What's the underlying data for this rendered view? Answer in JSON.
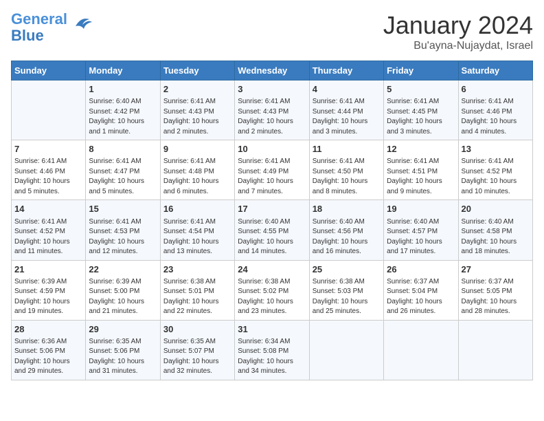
{
  "header": {
    "logo_general": "General",
    "logo_blue": "Blue",
    "month": "January 2024",
    "location": "Bu'ayna-Nujaydat, Israel"
  },
  "days_of_week": [
    "Sunday",
    "Monday",
    "Tuesday",
    "Wednesday",
    "Thursday",
    "Friday",
    "Saturday"
  ],
  "weeks": [
    [
      {
        "day": "",
        "content": ""
      },
      {
        "day": "1",
        "content": "Sunrise: 6:40 AM\nSunset: 4:42 PM\nDaylight: 10 hours\nand 1 minute."
      },
      {
        "day": "2",
        "content": "Sunrise: 6:41 AM\nSunset: 4:43 PM\nDaylight: 10 hours\nand 2 minutes."
      },
      {
        "day": "3",
        "content": "Sunrise: 6:41 AM\nSunset: 4:43 PM\nDaylight: 10 hours\nand 2 minutes."
      },
      {
        "day": "4",
        "content": "Sunrise: 6:41 AM\nSunset: 4:44 PM\nDaylight: 10 hours\nand 3 minutes."
      },
      {
        "day": "5",
        "content": "Sunrise: 6:41 AM\nSunset: 4:45 PM\nDaylight: 10 hours\nand 3 minutes."
      },
      {
        "day": "6",
        "content": "Sunrise: 6:41 AM\nSunset: 4:46 PM\nDaylight: 10 hours\nand 4 minutes."
      }
    ],
    [
      {
        "day": "7",
        "content": "Sunrise: 6:41 AM\nSunset: 4:46 PM\nDaylight: 10 hours\nand 5 minutes."
      },
      {
        "day": "8",
        "content": "Sunrise: 6:41 AM\nSunset: 4:47 PM\nDaylight: 10 hours\nand 5 minutes."
      },
      {
        "day": "9",
        "content": "Sunrise: 6:41 AM\nSunset: 4:48 PM\nDaylight: 10 hours\nand 6 minutes."
      },
      {
        "day": "10",
        "content": "Sunrise: 6:41 AM\nSunset: 4:49 PM\nDaylight: 10 hours\nand 7 minutes."
      },
      {
        "day": "11",
        "content": "Sunrise: 6:41 AM\nSunset: 4:50 PM\nDaylight: 10 hours\nand 8 minutes."
      },
      {
        "day": "12",
        "content": "Sunrise: 6:41 AM\nSunset: 4:51 PM\nDaylight: 10 hours\nand 9 minutes."
      },
      {
        "day": "13",
        "content": "Sunrise: 6:41 AM\nSunset: 4:52 PM\nDaylight: 10 hours\nand 10 minutes."
      }
    ],
    [
      {
        "day": "14",
        "content": "Sunrise: 6:41 AM\nSunset: 4:52 PM\nDaylight: 10 hours\nand 11 minutes."
      },
      {
        "day": "15",
        "content": "Sunrise: 6:41 AM\nSunset: 4:53 PM\nDaylight: 10 hours\nand 12 minutes."
      },
      {
        "day": "16",
        "content": "Sunrise: 6:41 AM\nSunset: 4:54 PM\nDaylight: 10 hours\nand 13 minutes."
      },
      {
        "day": "17",
        "content": "Sunrise: 6:40 AM\nSunset: 4:55 PM\nDaylight: 10 hours\nand 14 minutes."
      },
      {
        "day": "18",
        "content": "Sunrise: 6:40 AM\nSunset: 4:56 PM\nDaylight: 10 hours\nand 16 minutes."
      },
      {
        "day": "19",
        "content": "Sunrise: 6:40 AM\nSunset: 4:57 PM\nDaylight: 10 hours\nand 17 minutes."
      },
      {
        "day": "20",
        "content": "Sunrise: 6:40 AM\nSunset: 4:58 PM\nDaylight: 10 hours\nand 18 minutes."
      }
    ],
    [
      {
        "day": "21",
        "content": "Sunrise: 6:39 AM\nSunset: 4:59 PM\nDaylight: 10 hours\nand 19 minutes."
      },
      {
        "day": "22",
        "content": "Sunrise: 6:39 AM\nSunset: 5:00 PM\nDaylight: 10 hours\nand 21 minutes."
      },
      {
        "day": "23",
        "content": "Sunrise: 6:38 AM\nSunset: 5:01 PM\nDaylight: 10 hours\nand 22 minutes."
      },
      {
        "day": "24",
        "content": "Sunrise: 6:38 AM\nSunset: 5:02 PM\nDaylight: 10 hours\nand 23 minutes."
      },
      {
        "day": "25",
        "content": "Sunrise: 6:38 AM\nSunset: 5:03 PM\nDaylight: 10 hours\nand 25 minutes."
      },
      {
        "day": "26",
        "content": "Sunrise: 6:37 AM\nSunset: 5:04 PM\nDaylight: 10 hours\nand 26 minutes."
      },
      {
        "day": "27",
        "content": "Sunrise: 6:37 AM\nSunset: 5:05 PM\nDaylight: 10 hours\nand 28 minutes."
      }
    ],
    [
      {
        "day": "28",
        "content": "Sunrise: 6:36 AM\nSunset: 5:06 PM\nDaylight: 10 hours\nand 29 minutes."
      },
      {
        "day": "29",
        "content": "Sunrise: 6:35 AM\nSunset: 5:06 PM\nDaylight: 10 hours\nand 31 minutes."
      },
      {
        "day": "30",
        "content": "Sunrise: 6:35 AM\nSunset: 5:07 PM\nDaylight: 10 hours\nand 32 minutes."
      },
      {
        "day": "31",
        "content": "Sunrise: 6:34 AM\nSunset: 5:08 PM\nDaylight: 10 hours\nand 34 minutes."
      },
      {
        "day": "",
        "content": ""
      },
      {
        "day": "",
        "content": ""
      },
      {
        "day": "",
        "content": ""
      }
    ]
  ]
}
